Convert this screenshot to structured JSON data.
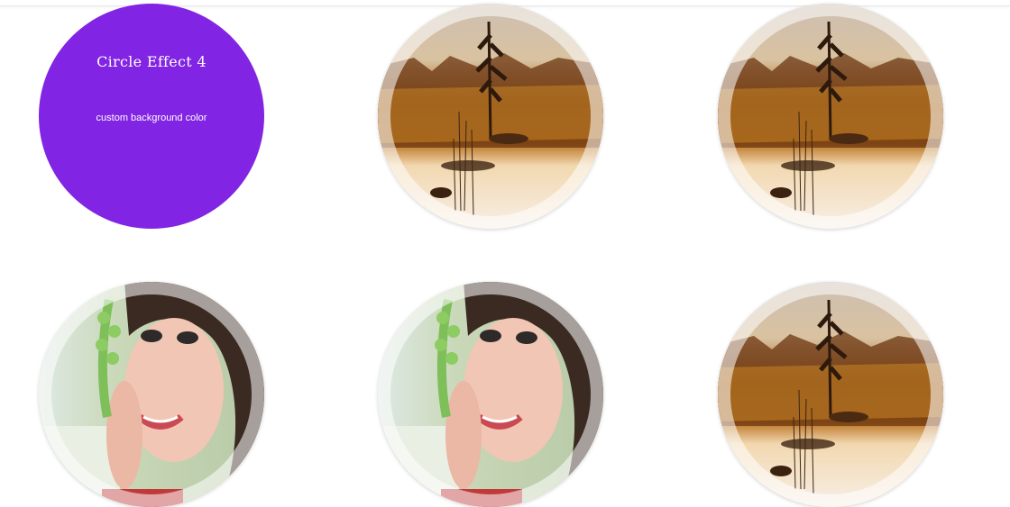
{
  "page": {
    "background": "#ffffff"
  },
  "circles": [
    {
      "kind": "text",
      "title": "Circle Effect 4",
      "subtitle": "custom background color",
      "background": "#8224e3"
    },
    {
      "kind": "image",
      "image": "lake-sunrise-photo"
    },
    {
      "kind": "image",
      "image": "lake-sunrise-photo"
    },
    {
      "kind": "image",
      "image": "smiling-woman-photo"
    },
    {
      "kind": "image",
      "image": "smiling-woman-photo"
    },
    {
      "kind": "image",
      "image": "lake-sunrise-photo"
    }
  ]
}
